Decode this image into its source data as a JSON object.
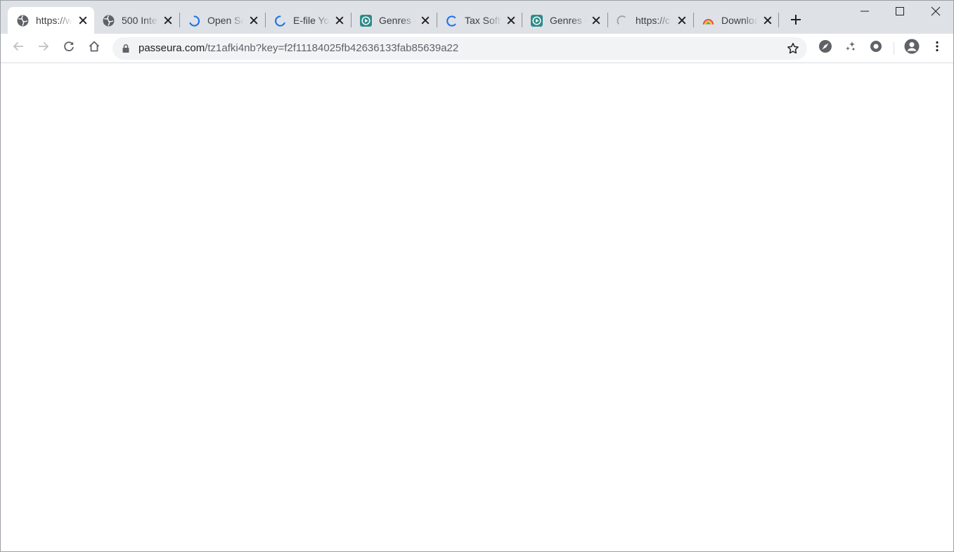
{
  "browser": {
    "tabs": [
      {
        "title": "https://w",
        "favicon": "globe-icon",
        "active": true
      },
      {
        "title": "500 Inte",
        "favicon": "globe-icon",
        "active": false
      },
      {
        "title": "Open Sc",
        "favicon": "loading-spinner-icon",
        "active": false
      },
      {
        "title": "E-file Yo",
        "favicon": "loading-spinner-icon",
        "active": false
      },
      {
        "title": "Genres o",
        "favicon": "play-app-icon",
        "active": false
      },
      {
        "title": "Tax Softw",
        "favicon": "loading-spinner-icon",
        "active": false
      },
      {
        "title": "Genres o",
        "favicon": "play-app-icon",
        "active": false
      },
      {
        "title": "https://c",
        "favicon": "loading-spinner-gray-icon",
        "active": false
      },
      {
        "title": "Downloa",
        "favicon": "rainbow-icon",
        "active": false
      }
    ],
    "address_bar": {
      "host": "passeura.com",
      "path": "/tz1afki4nb?key=f2f11184025fb42636133fab85639a22"
    },
    "colors": {
      "tabstrip_bg": "#dee1e6",
      "omnibox_bg": "#f1f3f4",
      "spinner_blue": "#1a73e8",
      "app_teal": "#2e8b8b",
      "icon_gray": "#5f6368"
    }
  }
}
